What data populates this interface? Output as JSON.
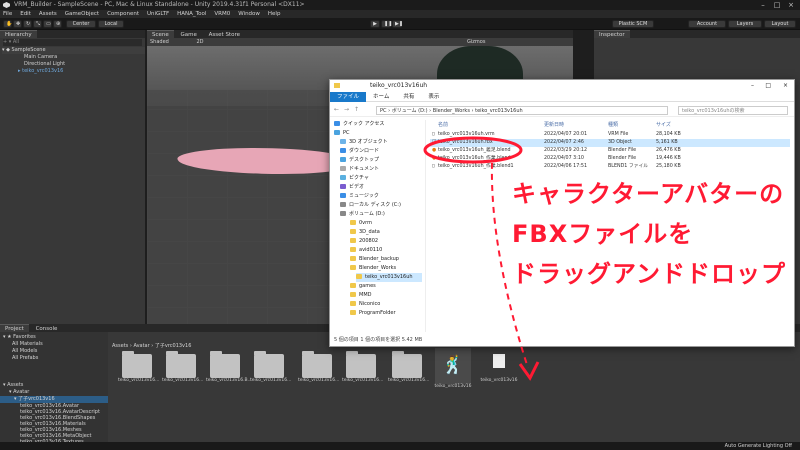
{
  "window": {
    "title": "VRM_Builder - SampleScene - PC, Mac & Linux Standalone - Unity 2019.4.31f1 Personal <DX11>"
  },
  "menubar": [
    "File",
    "Edit",
    "Assets",
    "GameObject",
    "Component",
    "UniGLTF",
    "HANA_Tool",
    "VRM0",
    "Window",
    "Help"
  ],
  "toolbar": {
    "center": "Center",
    "local": "Local",
    "plastic": "Plastic SCM",
    "account": "Account",
    "layers": "Layers",
    "layout": "Layout"
  },
  "hierarchy": {
    "tab": "Hierarchy",
    "search_placeholder": "All",
    "items": [
      "SampleScene",
      "Main Camera",
      "Directional Light",
      "teiko_vrc013v16"
    ]
  },
  "scene": {
    "tabs": [
      "Scene",
      "Game",
      "Asset Store"
    ],
    "shading": "Shaded",
    "mode": "2D",
    "gizmos": "Gizmos"
  },
  "inspector": {
    "tab": "Inspector"
  },
  "explorer": {
    "title": "teiko_vrc013v16uh",
    "ribbon": [
      "ファイル",
      "ホーム",
      "共有",
      "表示"
    ],
    "address": [
      "PC",
      "ボリューム (D:)",
      "Blender_Works",
      "teiko_vrc013v16uh"
    ],
    "search_placeholder": "teiko_vrc013v16uhの検索",
    "nav": [
      "クイック アクセス",
      "PC",
      "3D オブジェクト",
      "ダウンロード",
      "デスクトップ",
      "ドキュメント",
      "ピクチャ",
      "ビデオ",
      "ミュージック",
      "ローカル ディスク (C:)",
      "ボリューム (D:)",
      "0vrm",
      "3D_data",
      "200802",
      "avid0110",
      "Blender_backup",
      "Blender_Works",
      "teiko_vrc013v16uh",
      "games",
      "MMD",
      "Niconico",
      "ProgramFolder"
    ],
    "columns": [
      "名前",
      "更新日時",
      "種類",
      "サイズ"
    ],
    "files": [
      {
        "name": "teiko_vrc013v16uh.vrm",
        "date": "2022/04/07 20:01",
        "type": "VRM File",
        "size": "28,104 KB"
      },
      {
        "name": "teiko_vrc013v16uh.fbx",
        "date": "2022/04/07 2:46",
        "type": "3D Object",
        "size": "5,161 KB"
      },
      {
        "name": "teiko_vrc013v16uh_義足.blend",
        "date": "2022/03/29 20:12",
        "type": "Blender File",
        "size": "26,476 KB"
      },
      {
        "name": "teiko_vrc013v16uh_作業.blend",
        "date": "2022/04/07 3:10",
        "type": "Blender File",
        "size": "19,446 KB"
      },
      {
        "name": "teiko_vrc013v16uh_作業.blend1",
        "date": "2022/04/06 17:51",
        "type": "BLEND1 ファイル",
        "size": "25,180 KB"
      }
    ],
    "status": "5 個の項目    1 個の項目を選択  5.42 MB"
  },
  "annotation": {
    "line1": "キャラクターアバターの",
    "line2": "FBXファイルを",
    "line3": "ドラッグアンドドロップ"
  },
  "project": {
    "tabs": [
      "Project",
      "Console"
    ],
    "favorites": [
      "Favorites",
      "All Materials",
      "All Models",
      "All Prefabs"
    ],
    "tree": [
      "Assets",
      "Avatar",
      "了子vrc013v16",
      "teiko_vrc013v16.Avatar",
      "teiko_vrc013v16.AvatarDescript",
      "teiko_vrc013v16.BlendShapes",
      "teiko_vrc013v16.Materials",
      "teiko_vrc013v16.Meshes",
      "teiko_vrc013v16.MetaObject",
      "teiko_vrc013v16.Textures"
    ],
    "breadcrumb": "Assets › Avatar › 了子vrc013v16",
    "assets": [
      "teiko_vrc013v16...",
      "teiko_vrc013v16...",
      "teiko_vrc013v16.B...",
      "teiko_vrc013v16...",
      "teiko_vrc013v16...",
      "teiko_vrc013v16...",
      "teiko_vrc013v16...",
      "teiko_vrc013v16",
      "teiko_vrc013v16"
    ]
  },
  "statusbar": {
    "text": "Auto Generate Lighting Off"
  },
  "colors": {
    "annotation": "#ff1a33",
    "selection": "#2c5d87",
    "explorer_accent": "#1979ca"
  }
}
